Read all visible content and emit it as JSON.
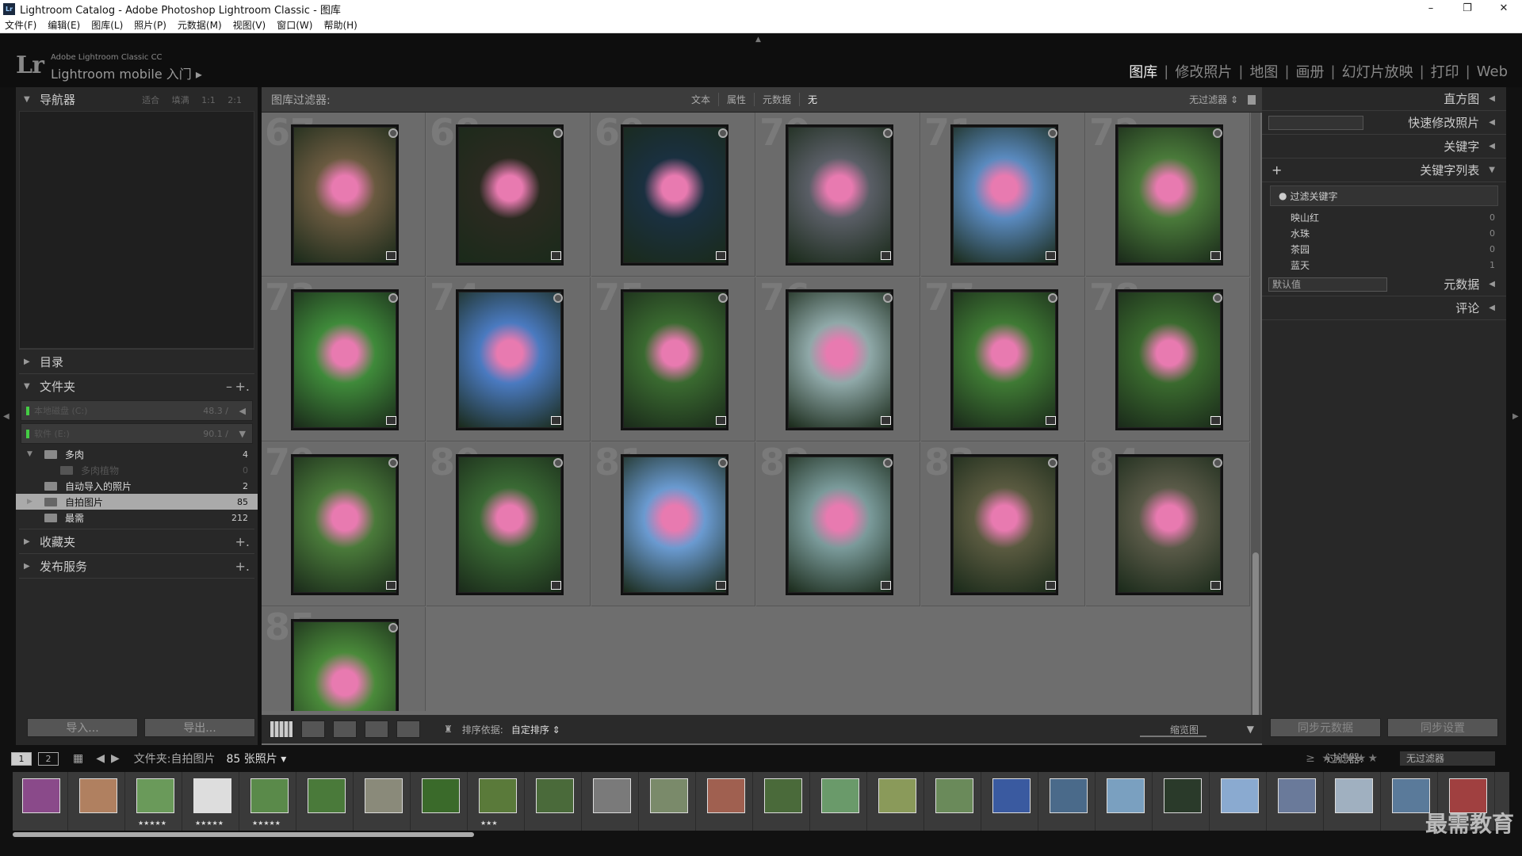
{
  "window": {
    "title": "Lightroom Catalog - Adobe Photoshop Lightroom Classic - 图库",
    "app_icon": "Lr",
    "min": "–",
    "max": "❐",
    "close": "✕"
  },
  "menu": [
    "文件(F)",
    "编辑(E)",
    "图库(L)",
    "照片(P)",
    "元数据(M)",
    "视图(V)",
    "窗口(W)",
    "帮助(H)"
  ],
  "identity": {
    "logo": "Lr",
    "small": "Adobe Lightroom Classic CC",
    "big": "Lightroom mobile 入门 ▸"
  },
  "modules": [
    {
      "label": "图库",
      "active": true
    },
    {
      "label": "修改照片",
      "active": false
    },
    {
      "label": "地图",
      "active": false
    },
    {
      "label": "画册",
      "active": false
    },
    {
      "label": "幻灯片放映",
      "active": false
    },
    {
      "label": "打印",
      "active": false
    },
    {
      "label": "Web",
      "active": false
    }
  ],
  "left": {
    "navigator": {
      "title": "导航器",
      "options": [
        "适合",
        "填满",
        "1:1",
        "2:1"
      ]
    },
    "catalog": "目录",
    "folders_title": "文件夹",
    "folders_minus": "–",
    "folders_plus": "+.",
    "volumes": [
      {
        "name": "本地磁盘 (C:)",
        "size": "48.3 /",
        "arrow": "◀"
      },
      {
        "name": "软件 (E:)",
        "size": "90.1 /",
        "arrow": "▼"
      }
    ],
    "folders": [
      {
        "name": "多肉",
        "count": "4",
        "tri": "▼",
        "sub": false,
        "selected": false
      },
      {
        "name": "多肉植物",
        "count": "0",
        "tri": "",
        "sub": true,
        "selected": false
      },
      {
        "name": "自动导入的照片",
        "count": "2",
        "tri": "",
        "sub": false,
        "selected": false
      },
      {
        "name": "自拍图片",
        "count": "85",
        "tri": "▶",
        "sub": false,
        "selected": true
      },
      {
        "name": "最需",
        "count": "212",
        "tri": "",
        "sub": false,
        "selected": false
      }
    ],
    "collections": "收藏夹",
    "publish": "发布服务",
    "import": "导入...",
    "export": "导出..."
  },
  "filterbar": {
    "label": "图库过滤器:",
    "tabs": [
      "文本",
      "属性",
      "元数据",
      "无"
    ],
    "active": "无",
    "preset": "无过滤器 ⇕"
  },
  "grid": {
    "cells": [
      {
        "idx": "67",
        "color": "#6a5a40"
      },
      {
        "idx": "68",
        "color": "#2a2a20"
      },
      {
        "idx": "69",
        "color": "#1a3040"
      },
      {
        "idx": "70",
        "color": "#5a5e66"
      },
      {
        "idx": "71",
        "color": "#5a8abf"
      },
      {
        "idx": "72",
        "color": "#4a7a3a"
      },
      {
        "idx": "73",
        "color": "#3f8a3a"
      },
      {
        "idx": "74",
        "color": "#4a7ac0"
      },
      {
        "idx": "75",
        "color": "#3a6a30"
      },
      {
        "idx": "76",
        "color": "#8fa8a8"
      },
      {
        "idx": "77",
        "color": "#3f7a34"
      },
      {
        "idx": "78",
        "color": "#3a6a2e"
      },
      {
        "idx": "79",
        "color": "#4a7a3a"
      },
      {
        "idx": "80",
        "color": "#3a6a34"
      },
      {
        "idx": "81",
        "color": "#6a9ad0"
      },
      {
        "idx": "82",
        "color": "#7a9a9a"
      },
      {
        "idx": "83",
        "color": "#5a5a40"
      },
      {
        "idx": "84",
        "color": "#5a5a48"
      },
      {
        "idx": "85",
        "color": "#4a8a3a"
      }
    ]
  },
  "toolbar": {
    "sort_label": "排序依据:",
    "sort_value": "自定排序 ⇕",
    "zoom": "缩览图"
  },
  "right": {
    "histogram": "直方图",
    "quick_develop": "快速修改照片",
    "keywording": "关键字",
    "keyword_list": "关键字列表",
    "keyword_list_plus": "+",
    "filter_keywords": "过滤关键字",
    "keywords": [
      {
        "name": "映山红",
        "count": "0"
      },
      {
        "name": "水珠",
        "count": "0"
      },
      {
        "name": "茶园",
        "count": "0"
      },
      {
        "name": "蓝天",
        "count": "1"
      }
    ],
    "metadata": "元数据",
    "metadata_preset": "默认值",
    "comments": "评论",
    "sync_metadata": "同步元数据",
    "sync_settings": "同步设置"
  },
  "filmstrip_bar": {
    "page1": "1",
    "page2": "2",
    "source": "文件夹:自拍图片",
    "count": "85 张照片 ▾",
    "filter_label": "过滤器:",
    "stars": "≥ ★★★★★",
    "no_filter": "无过滤器"
  },
  "filmstrip": [
    {
      "color": "#8a4a8a",
      "stars": ""
    },
    {
      "color": "#b08060",
      "stars": ""
    },
    {
      "color": "#6a9a5a",
      "stars": "★★★★★"
    },
    {
      "color": "#ddd",
      "stars": "★★★★★"
    },
    {
      "color": "#5a8a4a",
      "stars": "★★★★★"
    },
    {
      "color": "#4a7a3a",
      "stars": ""
    },
    {
      "color": "#8a8a7a",
      "stars": ""
    },
    {
      "color": "#3a6a2a",
      "stars": ""
    },
    {
      "color": "#5a7a3a",
      "stars": "★★★"
    },
    {
      "color": "#4a6a3a",
      "stars": ""
    },
    {
      "color": "#7a7a7a",
      "stars": ""
    },
    {
      "color": "#7a8a6a",
      "stars": ""
    },
    {
      "color": "#a06050",
      "stars": ""
    },
    {
      "color": "#4a6a3a",
      "stars": ""
    },
    {
      "color": "#6a9a6a",
      "stars": ""
    },
    {
      "color": "#8a9a5a",
      "stars": ""
    },
    {
      "color": "#6a8a5a",
      "stars": ""
    },
    {
      "color": "#3a5aa0",
      "stars": ""
    },
    {
      "color": "#4a6a8a",
      "stars": ""
    },
    {
      "color": "#7aa0c0",
      "stars": ""
    },
    {
      "color": "#2a3a2a",
      "stars": ""
    },
    {
      "color": "#8aaad0",
      "stars": ""
    },
    {
      "color": "#6a7a9a",
      "stars": ""
    },
    {
      "color": "#a0b0c0",
      "stars": ""
    },
    {
      "color": "#5a7a9a",
      "stars": ""
    },
    {
      "color": "#a04040",
      "stars": ""
    }
  ],
  "watermark": "最需教育"
}
